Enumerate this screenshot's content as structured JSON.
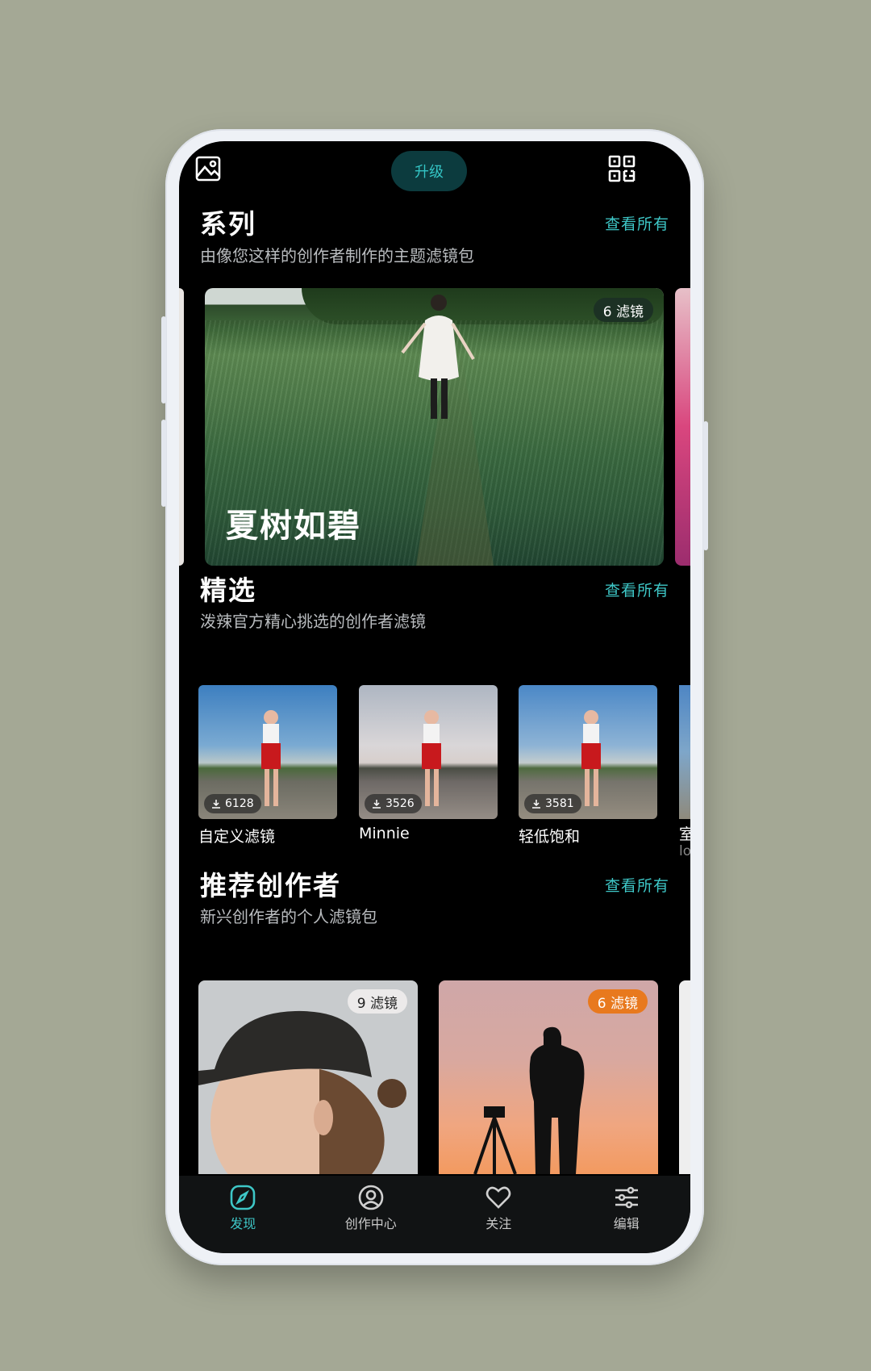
{
  "topbar": {
    "gallery_icon": "image-icon",
    "upgrade_label": "升级",
    "qr_icon": "qr-code-icon"
  },
  "series": {
    "title": "系列",
    "subtitle": "由像您这样的创作者制作的主题滤镜包",
    "see_all": "查看所有",
    "card": {
      "name": "夏树如碧",
      "badge": "6 滤镜"
    }
  },
  "picks": {
    "title": "精选",
    "subtitle": "泼辣官方精心挑选的创作者滤镜",
    "see_all": "查看所有",
    "items": [
      {
        "label": "自定义滤镜",
        "downloads": "6128"
      },
      {
        "label": "Minnie",
        "downloads": "3526"
      },
      {
        "label": "轻低饱和",
        "downloads": "3581"
      }
    ],
    "peek": {
      "label": "室",
      "sub": "lo"
    }
  },
  "creators": {
    "title": "推荐创作者",
    "subtitle": "新兴创作者的个人滤镜包",
    "see_all": "查看所有",
    "items": [
      {
        "badge": "9 滤镜",
        "badge_color": "#eceaea",
        "badge_text_color": "#222222"
      },
      {
        "badge": "6 滤镜",
        "badge_color": "#e8791e",
        "badge_text_color": "#ffffff"
      }
    ]
  },
  "nav": {
    "items": [
      {
        "label": "发现",
        "icon": "compass-icon",
        "active": true
      },
      {
        "label": "创作中心",
        "icon": "user-circle-icon",
        "active": false
      },
      {
        "label": "关注",
        "icon": "heart-icon",
        "active": false
      },
      {
        "label": "编辑",
        "icon": "sliders-icon",
        "active": false
      }
    ]
  },
  "colors": {
    "accent": "#3ec7c7",
    "background": "#000000",
    "page_bg": "#a4a895"
  }
}
